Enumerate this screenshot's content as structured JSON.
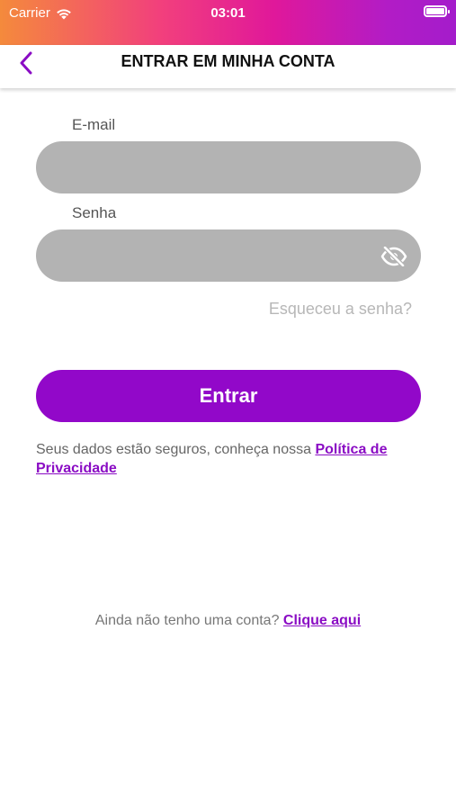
{
  "status": {
    "carrier": "Carrier",
    "time": "03:01"
  },
  "nav": {
    "title": "ENTRAR EM MINHA CONTA",
    "back_icon": "chevron-left-icon"
  },
  "form": {
    "email_label": "E-mail",
    "email_value": "",
    "password_label": "Senha",
    "password_value": "",
    "toggle_icon": "eye-off-icon",
    "forgot_label": "Esqueceu a senha?",
    "submit_label": "Entrar"
  },
  "privacy": {
    "text": "Seus dados estão seguros, conheça nossa ",
    "link": "Política de Privacidade"
  },
  "signup": {
    "text": "Ainda não tenho uma conta? ",
    "link": "Clique aqui"
  },
  "colors": {
    "accent": "#9208c9",
    "link": "#8a0cc4",
    "input_bg": "#b3b3b3",
    "status_gradient": [
      "#f48a3c",
      "#e0189a",
      "#a41ccb"
    ]
  }
}
